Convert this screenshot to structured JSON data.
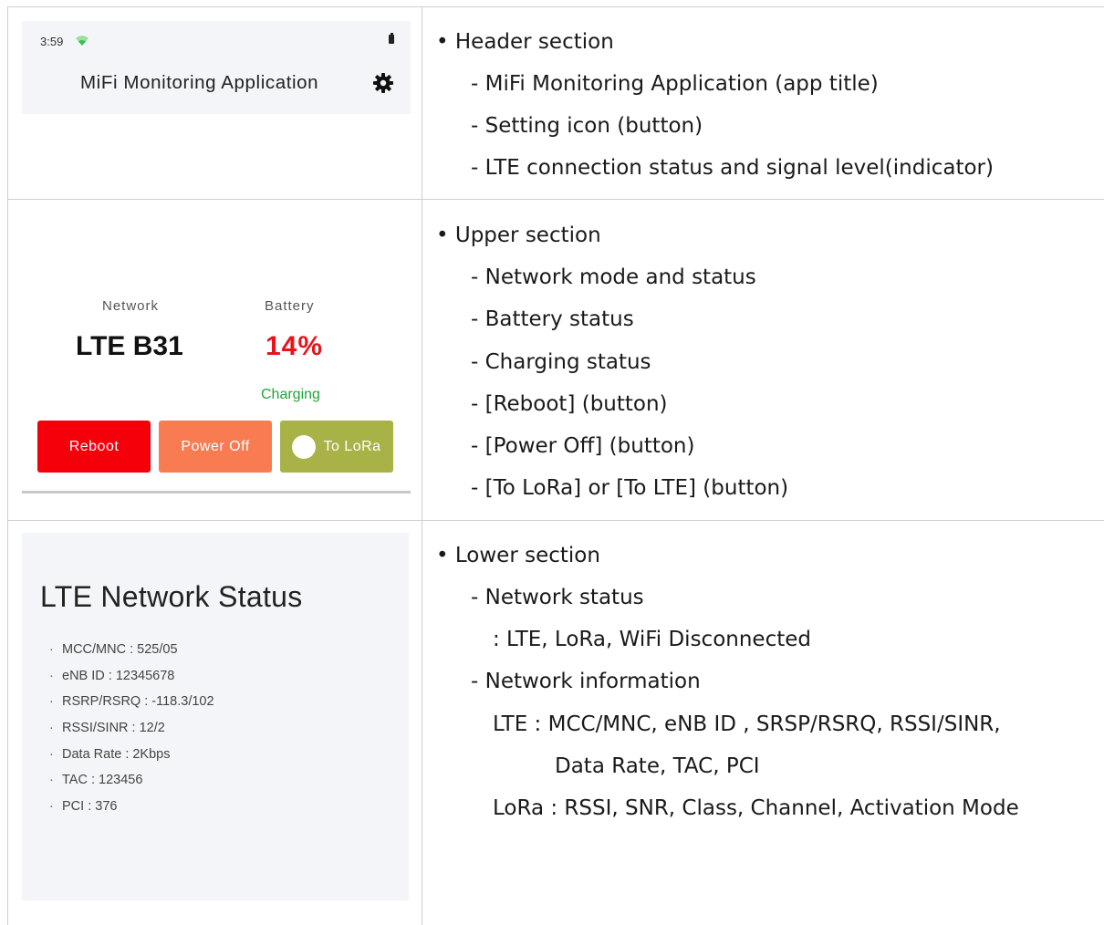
{
  "header_screenshot": {
    "time": "3:59",
    "title": "MiFi Monitoring Application",
    "icons": [
      "wifi-icon",
      "battery-icon",
      "gear-icon"
    ]
  },
  "upper_screenshot": {
    "network_label": "Network",
    "network_value": "LTE B31",
    "battery_label": "Battery",
    "battery_value": "14%",
    "charging_text": "Charging",
    "buttons": {
      "reboot": "Reboot",
      "power_off": "Power Off",
      "to_lora": "To LoRa"
    },
    "colors": {
      "battery_value": "#e8141a",
      "charging": "#1ea53a",
      "reboot": "#f5000a",
      "power_off": "#f87b52",
      "to_lora": "#a8b246"
    }
  },
  "lower_screenshot": {
    "title": "LTE Network Status",
    "items": [
      "MCC/MNC : 525/05",
      "eNB ID : 12345678",
      "RSRP/RSRQ : -118.3/102",
      "RSSI/SINR : 12/2",
      "Data Rate : 2Kbps",
      "TAC : 123456",
      "PCI : 376"
    ]
  },
  "descriptions": {
    "header": {
      "heading": "• Header section",
      "lines": [
        "- MiFi Monitoring Application (app title)",
        "- Setting icon (button)",
        "- LTE connection status and signal level(indicator)"
      ]
    },
    "upper": {
      "heading": "• Upper section",
      "lines": [
        "- Network mode and status",
        "- Battery status",
        "- Charging status",
        "- [Reboot] (button)",
        "- [Power Off] (button)",
        "- [To LoRa] or [To LTE] (button)"
      ]
    },
    "lower": {
      "heading": "• Lower section",
      "line1": "- Network status",
      "line2": ": LTE, LoRa, WiFi Disconnected",
      "line3": "- Network information",
      "line4": "LTE : MCC/MNC, eNB ID , SRSP/RSRQ, RSSI/SINR,",
      "line5": "Data Rate, TAC, PCI",
      "line6": "LoRa : RSSI, SNR, Class, Channel, Activation Mode"
    }
  }
}
